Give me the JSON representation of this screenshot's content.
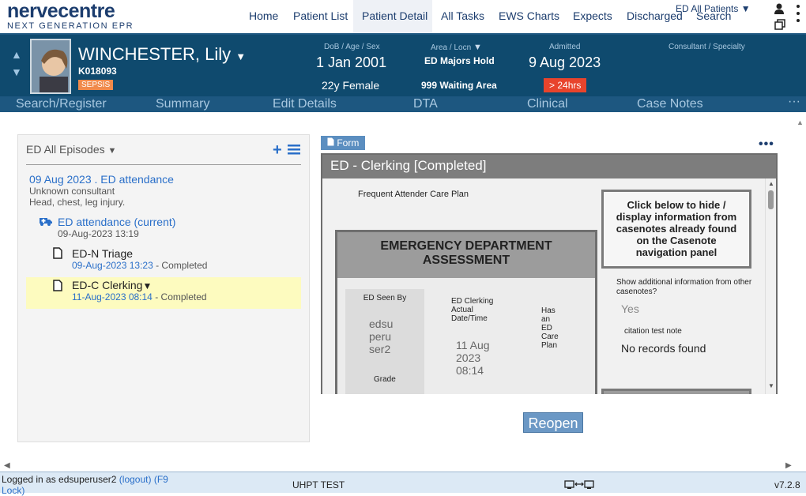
{
  "app": {
    "logo_name": "nervecentre",
    "logo_tagline": "NEXT GENERATION EPR"
  },
  "nav": {
    "items": [
      "Home",
      "Patient List",
      "Patient Detail",
      "All Tasks",
      "EWS Charts",
      "Expects",
      "Discharged",
      "Search"
    ],
    "active": "Patient Detail",
    "all_patients": "ED All Patients"
  },
  "patient": {
    "name": "WINCHESTER, Lily",
    "id": "K018093",
    "flag": "SEPSIS",
    "dob_label": "DoB / Age / Sex",
    "dob": "1 Jan 2001",
    "age_sex": "22y Female",
    "area_label": "Area / Locn",
    "area": "ED Majors Hold",
    "location": "999 Waiting Area",
    "admitted_label": "Admitted",
    "admitted": "9 Aug 2023",
    "duration": "> 24hrs",
    "consultant_label": "Consultant / Specialty"
  },
  "subnav": {
    "items": [
      "Search/Register",
      "Summary",
      "Edit Details",
      "DTA",
      "Clinical",
      "Case Notes"
    ],
    "more": "···"
  },
  "episodes": {
    "title": "ED All Episodes",
    "episode": {
      "title": "09 Aug 2023 . ED attendance",
      "consultant": "Unknown consultant",
      "complaint": "Head, chest, leg injury."
    },
    "attendance": {
      "title": "ED attendance (current)",
      "date": "09-Aug-2023 13:19"
    },
    "notes": [
      {
        "title": "ED-N Triage",
        "date": "09-Aug-2023 13:23",
        "status": "- Completed"
      },
      {
        "title": "ED-C Clerking",
        "date": "11-Aug-2023 08:14",
        "status": "- Completed"
      }
    ]
  },
  "form": {
    "button": "Form",
    "title": "ED - Clerking [Completed]",
    "care_plan": "Frequent Attender Care Plan",
    "heading": "EMERGENCY DEPARTMENT ASSESSMENT",
    "info_box": "Click below to hide / display information from casenotes already found on the Casenote navigation panel",
    "seen_by_label": "ED Seen By",
    "seen_by": "edsu peru ser2",
    "grade_label": "Grade",
    "clerking_label": "ED Clerking Actual Date/Time",
    "clerking": "11 Aug 2023 08:14",
    "care_plan_label": "Has an ED Care Plan",
    "show_info_label": "Show additional information from other casenotes?",
    "show_info": "Yes",
    "citation_label": "citation test note",
    "citation": "No records found"
  },
  "reopen": "Reopen",
  "status": {
    "logged_in": "Logged in as edsuperuser2",
    "logout": "(logout)",
    "lock": "(F9 Lock)",
    "site": "UHPT TEST",
    "version": "v7.2.8"
  }
}
